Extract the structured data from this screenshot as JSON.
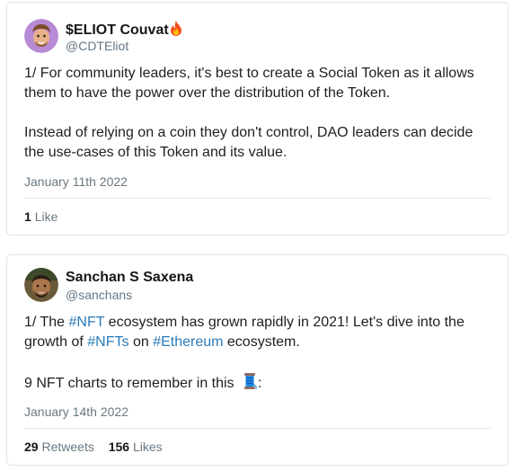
{
  "tweets": [
    {
      "display_name": "$ELIOT Couvat",
      "name_emoji": "fire-icon",
      "handle": "@CDTEliot",
      "line1": "1/ For community leaders, it's best to create a Social Token as it allows",
      "line2": "them to have the power over the distribution of the Token.",
      "line3": "Instead of relying on a coin they don't control, DAO leaders can decide",
      "line4": "the use-cases of this Token and its value.",
      "date": "January 11th 2022",
      "likes_count": "1",
      "likes_label": "Like"
    },
    {
      "display_name": "Sanchan S Saxena",
      "handle": "@sanchans",
      "line1_a": "1/ The ",
      "line1_tag": "#NFT",
      "line1_b": " ecosystem has grown rapidly in 2021! Let's dive into the",
      "line2_a": "growth of ",
      "line2_tag1": "#NFTs",
      "line2_b": " on ",
      "line2_tag2": "#Ethereum",
      "line2_c": " ecosystem.",
      "line3_a": "9 NFT charts to remember in this ",
      "line3_emoji": "thread-spool-icon",
      "line3_b": ":",
      "date": "January 14th 2022",
      "retweets_count": "29",
      "retweets_label": "Retweets",
      "likes_count": "156",
      "likes_label": "Likes"
    }
  ],
  "colors": {
    "hashtag": "#2b7bb9",
    "meta": "#697882",
    "border": "#dfe3e6"
  }
}
